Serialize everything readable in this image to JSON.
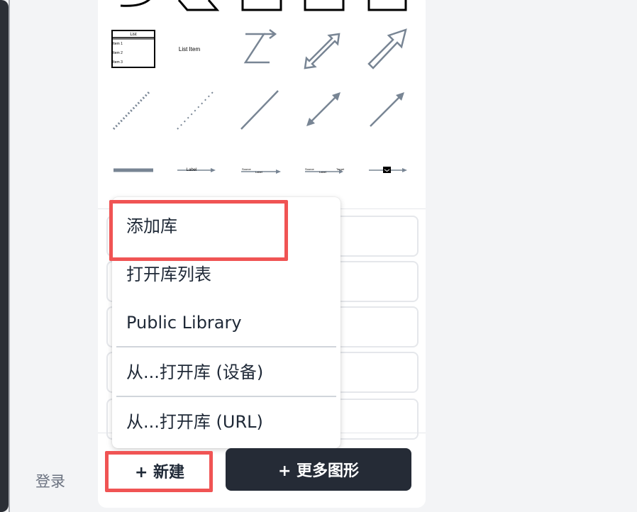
{
  "sidebar": {
    "login_label": "登录"
  },
  "shapes": {
    "list_title": "List",
    "list_items": [
      "Item 1",
      "Item 2",
      "Item 3"
    ],
    "list_item_label": "List Item",
    "edge_label": "Label",
    "edge_source_label": "Source",
    "edge_target_label": "Target"
  },
  "menu": {
    "items": [
      {
        "label": "添加库"
      },
      {
        "label": "打开库列表"
      },
      {
        "label": "Public Library"
      },
      {
        "label": "从...打开库 (设备)"
      },
      {
        "label": "从...打开库 (URL)"
      }
    ]
  },
  "footer": {
    "new_button": "+ 新建",
    "more_shapes_button": "+ 更多图形"
  },
  "colors": {
    "highlight": "#f05454",
    "dark_button": "#252b36",
    "shape_stroke": "#788594"
  }
}
